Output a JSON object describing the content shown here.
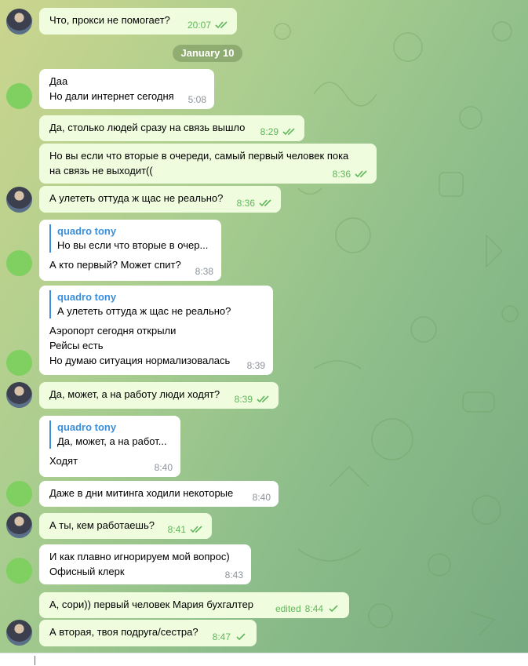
{
  "date_separator": "January 10",
  "messages": [
    {
      "text": "Что, прокси не помогает?",
      "time": "20:07",
      "out": true
    },
    {
      "text": "Даа\nНо дали интернет сегодня",
      "time": "5:08",
      "out": false
    },
    {
      "text": "Да, столько людей сразу на связь вышло",
      "time": "8:29",
      "out": true
    },
    {
      "text": "Но вы если что вторые в очереди, самый первый человек пока\nна связь не выходит((",
      "time": "8:36",
      "out": true
    },
    {
      "text": "А улететь оттуда ж щас не реально?",
      "time": "8:36",
      "out": true
    },
    {
      "reply_name": "quadro tony",
      "reply_text": "Но вы если что вторые в очер...",
      "text": "А кто первый? Может спит?",
      "time": "8:38",
      "out": false
    },
    {
      "reply_name": "quadro tony",
      "reply_text": "А улететь оттуда ж щас не реально?",
      "text": "Аэропорт сегодня открыли\nРейсы есть\nНо думаю ситуация нормализовалась",
      "time": "8:39",
      "out": false
    },
    {
      "text": "Да, может, а на работу люди ходят?",
      "time": "8:39",
      "out": true
    },
    {
      "reply_name": "quadro tony",
      "reply_text": "Да, может, а на работ...",
      "text": "Ходят",
      "time": "8:40",
      "out": false
    },
    {
      "text": "Даже в дни митинга ходили некоторые",
      "time": "8:40",
      "out": false
    },
    {
      "text": "А ты, кем работаешь?",
      "time": "8:41",
      "out": true
    },
    {
      "text": "И как плавно игнорируем мой вопрос)\nОфисный клерк",
      "time": "8:43",
      "out": false
    },
    {
      "text": "А, сори)) первый человек Мария бухгалтер",
      "time": "8:44",
      "edited": "edited",
      "out": true
    },
    {
      "text": "А вторая, твоя подруга/сестра?",
      "time": "8:47",
      "out": true
    }
  ]
}
